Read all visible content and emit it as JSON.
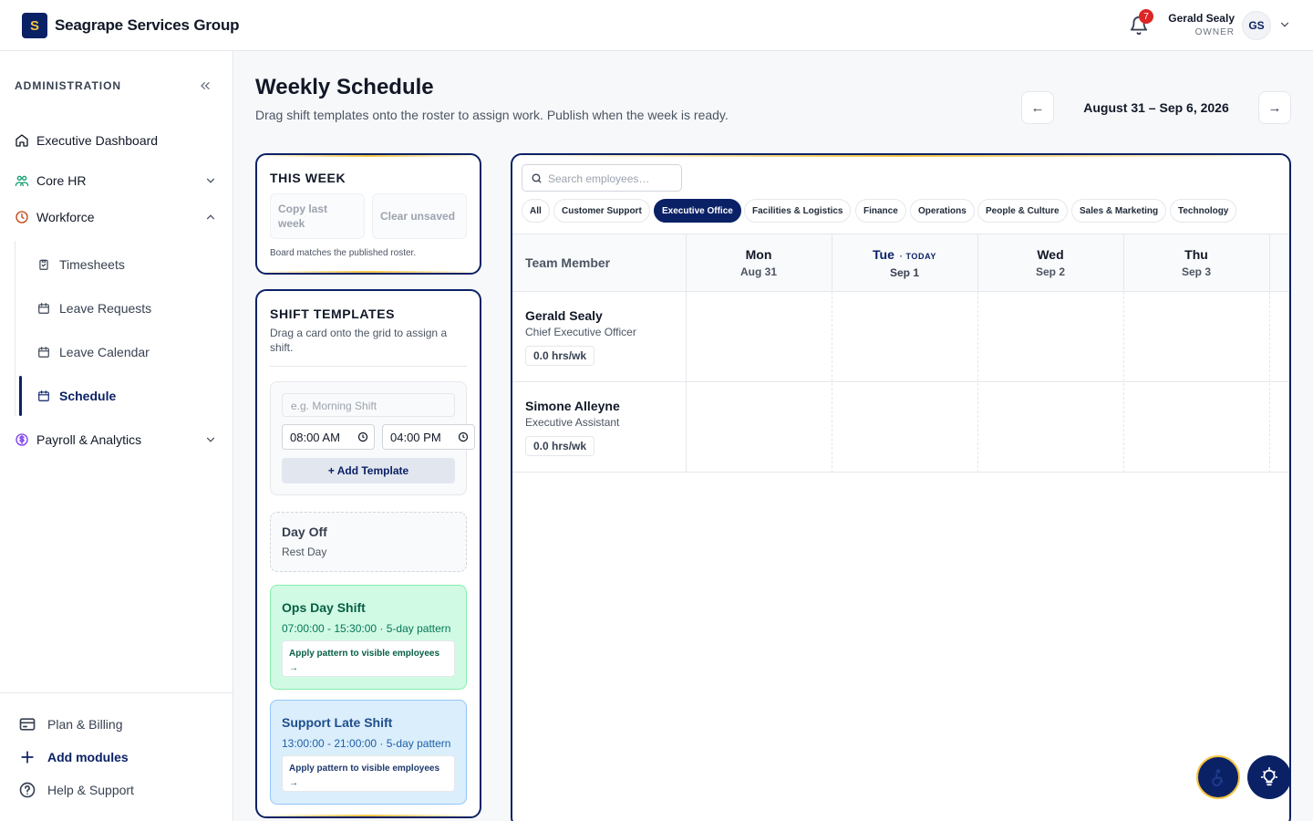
{
  "brand": {
    "logo_letter": "S",
    "name": "Seagrape Services Group",
    "accent": "#0b2166",
    "gold": "#f5c542"
  },
  "header": {
    "notifications_count": "7",
    "user_name": "Gerald Sealy",
    "user_role": "OWNER",
    "user_initials": "GS"
  },
  "sidebar": {
    "heading": "ADMINISTRATION",
    "items": [
      {
        "label": "Executive Dashboard",
        "icon": "home-icon"
      },
      {
        "label": "Core HR",
        "icon": "people-icon"
      },
      {
        "label": "Workforce",
        "icon": "clock-icon"
      },
      {
        "label": "Payroll & Analytics",
        "icon": "dollar-icon"
      }
    ],
    "workforce_sub": [
      {
        "label": "Timesheets",
        "icon": "clipboard-icon"
      },
      {
        "label": "Leave Requests",
        "icon": "calendar-icon"
      },
      {
        "label": "Leave Calendar",
        "icon": "calendar-icon"
      },
      {
        "label": "Schedule",
        "icon": "calendar-icon",
        "active": true
      }
    ],
    "footer": [
      {
        "label": "Plan & Billing",
        "icon": "credit-card-icon"
      },
      {
        "label": "Add modules",
        "icon": "plus-icon"
      },
      {
        "label": "Help & Support",
        "icon": "help-icon"
      }
    ]
  },
  "page": {
    "title": "Weekly Schedule",
    "subtitle": "Drag shift templates onto the roster to assign work. Publish when the week is ready.",
    "week_label": "August 31 – Sep 6, 2026",
    "prev": "←",
    "next": "→"
  },
  "this_week": {
    "heading": "THIS WEEK",
    "copy_label": "Copy last week",
    "clear_label": "Clear unsaved",
    "note": "Board matches the published roster."
  },
  "templates": {
    "heading": "SHIFT TEMPLATES",
    "description": "Drag a card onto the grid to assign a shift.",
    "name_placeholder": "e.g. Morning Shift",
    "start_time": "08:00 AM",
    "end_time": "04:00 PM",
    "add_label": "+ Add Template",
    "cards": [
      {
        "title": "Day Off",
        "subtitle": "Rest Day"
      },
      {
        "title": "Ops Day Shift",
        "subtitle": "07:00:00 - 15:30:00 · 5-day pattern",
        "apply": "Apply pattern to visible employees →"
      },
      {
        "title": "Support Late Shift",
        "subtitle": "13:00:00 - 21:00:00 · 5-day pattern",
        "apply": "Apply pattern to visible employees →"
      }
    ]
  },
  "roster": {
    "search_placeholder": "Search employees…",
    "filters": [
      "All",
      "Customer Support",
      "Executive Office",
      "Facilities & Logistics",
      "Finance",
      "Operations",
      "People & Culture",
      "Sales & Marketing",
      "Technology"
    ],
    "active_filter": "Executive Office",
    "column_label": "Team Member",
    "days": [
      {
        "name": "Mon",
        "date": "Aug 31"
      },
      {
        "name": "Tue",
        "date": "Sep 1",
        "today": "· TODAY"
      },
      {
        "name": "Wed",
        "date": "Sep 2"
      },
      {
        "name": "Thu",
        "date": "Sep 3"
      }
    ],
    "employees": [
      {
        "name": "Gerald Sealy",
        "role": "Chief Executive Officer",
        "hours": "0.0 hrs/wk"
      },
      {
        "name": "Simone Alleyne",
        "role": "Executive Assistant",
        "hours": "0.0 hrs/wk"
      }
    ]
  }
}
